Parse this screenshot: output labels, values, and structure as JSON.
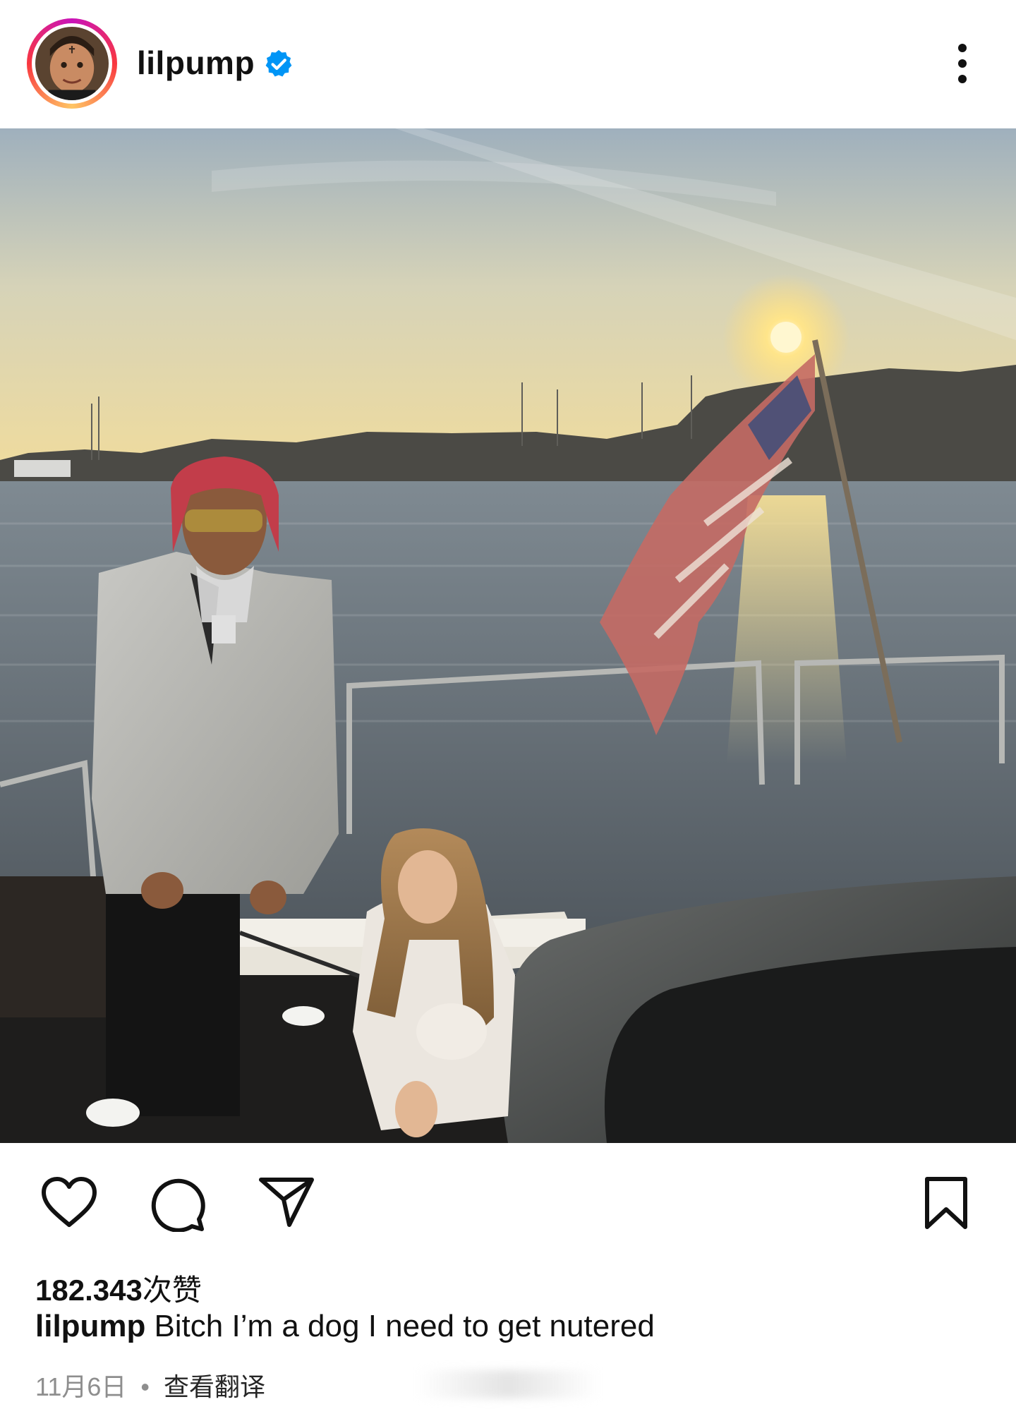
{
  "post": {
    "username": "lilpump",
    "verified": true,
    "likes_count": "182.343",
    "likes_unit": "次赞",
    "caption_user": "lilpump",
    "caption_text": "Bitch I’m a dog I need to get nutered",
    "date": "11月6日",
    "separator": "•",
    "translate_label": "查看翻译"
  },
  "icons": {
    "more": "more-vertical-icon",
    "like": "heart-icon",
    "comment": "comment-icon",
    "share": "send-icon",
    "save": "bookmark-icon",
    "verified": "verified-badge-icon"
  },
  "colors": {
    "verified_blue": "#0095f6",
    "text": "#111111",
    "muted": "#8e8e8e"
  }
}
